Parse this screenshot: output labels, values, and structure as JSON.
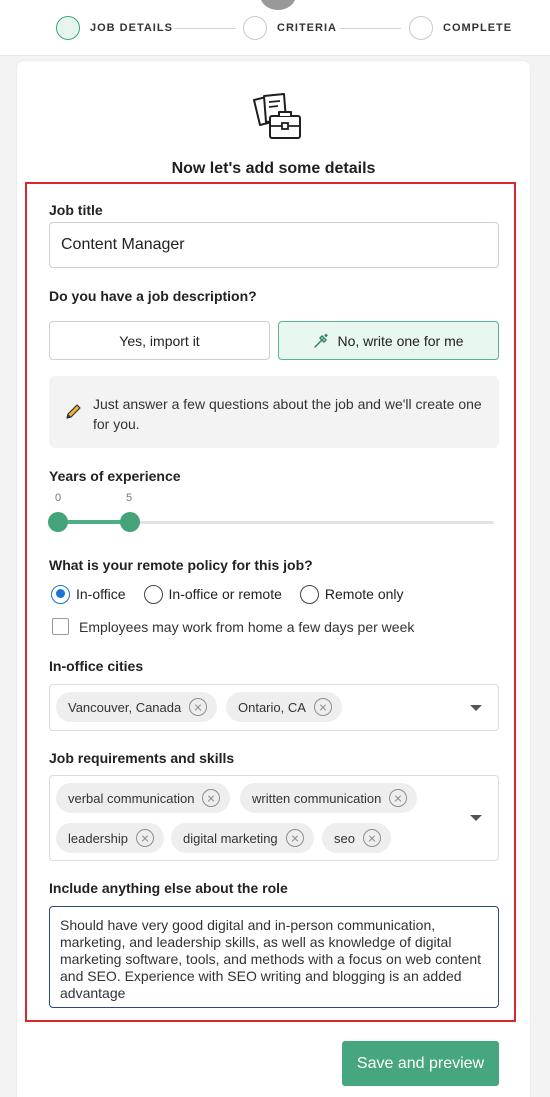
{
  "stepper": {
    "steps": [
      {
        "label": "JOB DETAILS",
        "active": true
      },
      {
        "label": "CRITERIA",
        "active": false
      },
      {
        "label": "COMPLETE",
        "active": false
      }
    ]
  },
  "page": {
    "heading": "Now let's add some details",
    "hero_icon": "documents-briefcase-icon"
  },
  "form": {
    "job_title": {
      "label": "Job title",
      "value": "Content Manager"
    },
    "job_description": {
      "label": "Do you have a job description?",
      "options": [
        {
          "label": "Yes, import it",
          "selected": false
        },
        {
          "label": "No, write one for me",
          "selected": true,
          "icon": "wand-icon"
        }
      ],
      "info": "Just answer a few questions about the job and we'll create one for you."
    },
    "experience": {
      "label": "Years of experience",
      "min_label": "0",
      "max_label": "5",
      "range": [
        0,
        5
      ]
    },
    "remote_policy": {
      "label": "What is your remote policy for this job?",
      "options": [
        {
          "label": "In-office",
          "checked": true
        },
        {
          "label": "In-office or remote",
          "checked": false
        },
        {
          "label": "Remote only",
          "checked": false
        }
      ],
      "wfh_checkbox": {
        "label": "Employees may work from home a few days per week",
        "checked": false
      }
    },
    "cities": {
      "label": "In-office cities",
      "chips": [
        "Vancouver, Canada",
        "Ontario, CA"
      ]
    },
    "skills": {
      "label": "Job requirements and skills",
      "chips": [
        "verbal communication",
        "written communication",
        "leadership",
        "digital marketing",
        "seo"
      ]
    },
    "other": {
      "label": "Include anything else about the role",
      "value": "Should have very good digital and in-person communication, marketing, and leadership skills, as well as knowledge of digital marketing software, tools, and methods with a focus on web content and SEO. Experience with SEO writing and blogging is an added advantage"
    }
  },
  "actions": {
    "save_label": "Save and preview"
  },
  "colors": {
    "accent": "#46a77e",
    "highlight_border": "#d9272e",
    "radio_checked": "#1976d2"
  }
}
